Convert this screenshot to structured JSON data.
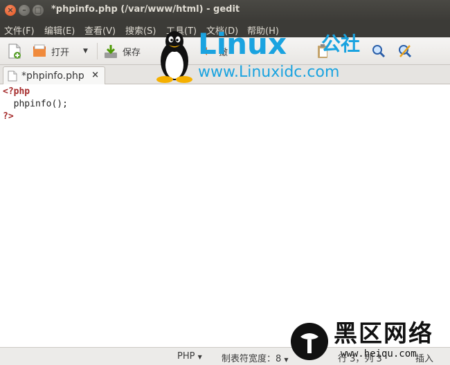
{
  "window": {
    "title": "*phpinfo.php (/var/www/html) - gedit"
  },
  "menu": [
    "文件(F)",
    "编辑(E)",
    "查看(V)",
    "搜索(S)",
    "工具(T)",
    "文档(D)",
    "帮助(H)"
  ],
  "toolbar": {
    "open_label": "打开",
    "save_label": "保存",
    "undo_label": "撤"
  },
  "tab": {
    "label": "*phpinfo.php"
  },
  "editor": {
    "lines": [
      "<?php",
      "  phpinfo();",
      "?>"
    ]
  },
  "status": {
    "language": "PHP",
    "tab_width": "制表符宽度：8",
    "position": "行 3，列 3",
    "insert_mode": "插入"
  },
  "watermarks": {
    "linux_text": "Linux",
    "linux_cn": "公社",
    "linux_url": "www.Linuxidc.com",
    "heiqu_cn": "黑区网络",
    "heiqu_url": "www.heiqu.com"
  },
  "colors": {
    "titlebar": "#3c3b37",
    "close": "#e2541e",
    "keyword": "#a52a2a",
    "watermark_blue": "#1aa3e0"
  }
}
